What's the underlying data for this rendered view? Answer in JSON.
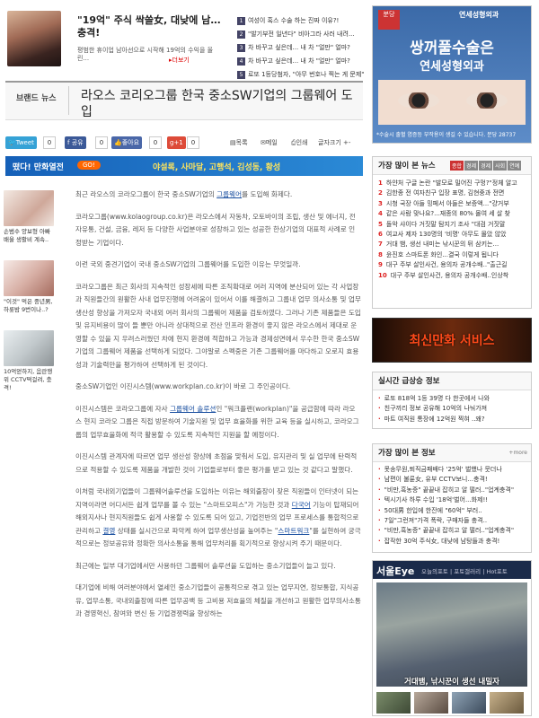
{
  "top_ad": {
    "title": "\"19억\" 주식 싹쓸女, 대낮에 남‥.충격!",
    "desc": "평범한 휴이업 남아선으로 시작해 19억의 수익을 올린...",
    "more": "▸더보기",
    "list": [
      {
        "num": "1",
        "text": "여성이 혹스 수술 하는 진짜 이유?!"
      },
      {
        "num": "2",
        "text": "\"발기부전 일년다\" 비아그라 사러 내려..."
      },
      {
        "num": "3",
        "text": "차 바꾸고 싶은데... 내 차 \"얼만\" 얼마?"
      },
      {
        "num": "4",
        "text": "차 바꾸고 싶은데... 내 차 \"얼만\" 얼마?"
      },
      {
        "num": "5",
        "text": "로또 1등당첨자, \"아무 번호나 찍는 게 문제\""
      }
    ]
  },
  "right_ad": {
    "badge": "분당",
    "brand": "연세성형외과",
    "headline": "쌍꺼풀수술은",
    "sub": "연세성형외과",
    "note": "*수술시 출혈 염증등 부작용이 생길 수 있습니다. 분당 28737"
  },
  "article_header": {
    "brand_news": "브랜드 뉴스",
    "title": "라오스 코리오그룹 한국 중소SW기업의 그룹웨어 도입"
  },
  "share": {
    "tweet": "Tweet",
    "tweet_count": "0",
    "fb": "공유",
    "fb_count": "0",
    "like": "좋아요",
    "like_count": "0",
    "gplus": "g+1",
    "gplus_count": "0",
    "tools": [
      "목록",
      "메일",
      "인쇄",
      "글자크기"
    ]
  },
  "banner": {
    "left": "떴다! 만화열전",
    "go": "GO!",
    "right": "야설록, 사마달, 고행석, 김성동, 황성"
  },
  "left_thumbs": [
    {
      "caption": "손범수 양보형 아빠 배울 생활비 계속.."
    },
    {
      "caption": "\"이것\" 먹은 중년男, 하룻밤 9번이나..?"
    },
    {
      "caption": "10억얻하지, 음란행위 CCTV떡걸려, 충격!"
    }
  ],
  "article": {
    "p1": "최근 라오스의 코라오그룹이 한국 중소SW기업의 ",
    "p1_link": "그룹웨어",
    "p1_end": "를 도입해 화제다.",
    "p2": "코라오그룹(www.kolaogroup.co.kr)은 라오스에서 자동차, 오토바이의 조립, 생산 및 에너지, 전자유통, 건설, 금융, 레저 등 다양한 사업분야로 성장하고 있는 성공한 한상기업의 대표적 사례로 인정받는 기업이다.",
    "p3": "이런 국외 중견기업이 국내 중소SW기업의 그룹웨어를 도입한 이유는 무엇일까.",
    "p4": "코라오그룹은 최근 회사의 지속적인 성장세에 따른 조직확대로 여러 지역에 분산되어 있는 각 사업장과 직원들간의 원활한 사내 업무진행에 어려움이 있어서 이를 해결하고 그룹내 업무 의사소통 및 업무생산성 향상을 가져오자 국내외 여러 회사의 그룹웨어 제품을 검토하였다. 그러나 기존 제품들은 도입 및 유지비용이 많이 들 뿐만 아니라 상대적으로 전산 인프라 환경이 좋지 않은 라오스에서 제대로 운영할 수 있을 지 우려스러웠던 차에 현지 환경에 적합하고 가능과 경제성면에서 우수한 한국 중소SW기업의 그룹웨어 제품을 선택하게 되었다. 그야말로 스펙중은 기존 그룹웨어를 마다하고 오로지 효용성과 기술력만을 평가하여 선택하게 된 것이다.",
    "p5": "중소SW기업인 이진시스템(www.workplan.co.kr)이 바로 그 주인공이다.",
    "p6a": "이진시스템은 코라오그룹에 자사 ",
    "p6_link": "그룹웨어 솔루션",
    "p6b": "인 \"워크플랜(workplan)\"을 공급함에 따라 라오스 현지 코라오 그룹은 직접 방문하여 기술지원 및 업무 효율화를 위한 교육 등을 실시하고, 코라오그룹의 업무효율화에 적극 활용할 수 있도록 지속적인 지원을 할 예정이다.",
    "p7": "이진시스템 관계자에 따르면 업무 생산성 향상에 초점을 맞춰서 도입, 유지관리 및 실 업무에 탄력적으로 적용할 수 있도록 제품을 개발한 것이 기업들로부터 좋은 평가를 받고 있는 것 같다고 말했다.",
    "p8a": "이처럼 국내외기업들이 그룹웨어솔루션을 도입하는 이유는 해외출장이 잦은 직원들이 인터넷이 되는 지역이라면 어디서든 쉽게 업무를 볼 수 있는 \"스마트오피스\"가 가능한 것과 ",
    "p8_link1": "다국어",
    "p8b": " 기능이 탑재되어 해외지사나 현지직원들도 쉽게 사용할 수 있도록 되어 있고, 기업전반의 업무 프로세스를 통합적으로 관리하고 ",
    "p8_link2": "결영",
    "p8c": " 상태를 실시간으로 파악케 하여 업무생산성을 높여주는 \"",
    "p8_link3": "스마트워크",
    "p8d": "\"를 실현하여 궁극적으로는 정보공유와 정확한 의사소통을 통해 업무처리를 획기적으로 향상시켜 주기 때문이다.",
    "p9": "최근에는 일부 대기업에서만 사용하던 그룹웨어 솔루션을 도입하는 중소기업들이 늘고 있다.",
    "p10": "대기업에 비해 여러분야에서 열세인 중소기업들이 공통적으로 겪고 있는 업무지연, 정보통합, 지식공유, 업무소통, 국내외출장에 따른 업무공백 등 고비용 저효율의 체질을 개선하고 원활한 업무의사소통과 경영혁신, 참여와 변신 등 기업경쟁력을 향상하는"
  },
  "popular": {
    "title": "가장 많이 본 뉴스",
    "tabs": [
      "종합",
      "경제",
      "경제",
      "사회",
      "연예"
    ],
    "items": [
      {
        "rank": "1",
        "text": "하얀처 구글 논란 \"발모로 밀어진 구멍?\"정체 알고"
      },
      {
        "rank": "2",
        "text": "김한종 전 여자친구 입장 표명, 김현중과 전면"
      },
      {
        "rank": "3",
        "text": "시청 국장 아들 밍페서 아들은 보증액...\"걍거부"
      },
      {
        "rank": "4",
        "text": "같은 사람 맞나요?...재종의 80% 몰여 세 살 찾"
      },
      {
        "rank": "5",
        "text": "돌악 샤이다 거짓말 탐지기 조사 \"대검 거짓말"
      },
      {
        "rank": "6",
        "text": "여교사 제자 130명의 '비명' 아무도 몰았 않았"
      },
      {
        "rank": "7",
        "text": "거대 뱀, 생선 내미는 낚시꾼의 뒤 삼키는..."
      },
      {
        "rank": "8",
        "text": "윤진호 스마트폰 화인...결국 이렇게 됩니다"
      },
      {
        "rank": "9",
        "text": "대구 주부 살인사건, 용의자 공개수배..\"출근길"
      },
      {
        "rank": "10",
        "text": "대구 주부 살인사건, 용의자 공개수배..인상착"
      }
    ]
  },
  "ad2": {
    "text": "최신만화 서비스"
  },
  "rising": {
    "title": "실시간 급상승 정보",
    "items": [
      "로또 818억 1등 39명 다 한곳에서 나와",
      "친구끼리 정보 공유해 10억의 나눠가져",
      "마트 여직원 통장에 12억원 찍혀 ..왜?"
    ]
  },
  "most_viewed": {
    "title": "가장 많이 본 정보",
    "more": "+more",
    "items": [
      "못송무원,퇴직금패배다 '25억' 벌했나 뭇더나",
      "남편이 불륜女, 유부 CCTV보니...충격!",
      "\"비만,흑농증\" 끝끝내 잡히고 알 떨러..\"업계충격\"",
      "텍시기사 하루 수입 '18억'벌어...화제!!",
      "50대男 한입에 한잔에 \"60억\" 부러..",
      "7일\"그런져\"가격 폭락, 구매자들 충격..",
      "\"비만,흑농증\" 끝끝내 잡히고 알 떨러..\"업계충격\"",
      "잡작한 30억 주식女, 대낮에 남탕들과 충격!"
    ]
  },
  "seoul_eye": {
    "logo": "서울Eye",
    "tabs": "오늘의포토 | 포토갤러리 | Hot포토",
    "caption": "거대뱀, 낚시꾼이 생선 내밀자"
  },
  "colors": {
    "accent": "#1a4fa0",
    "banner": "#1560b8",
    "red": "#d22"
  }
}
